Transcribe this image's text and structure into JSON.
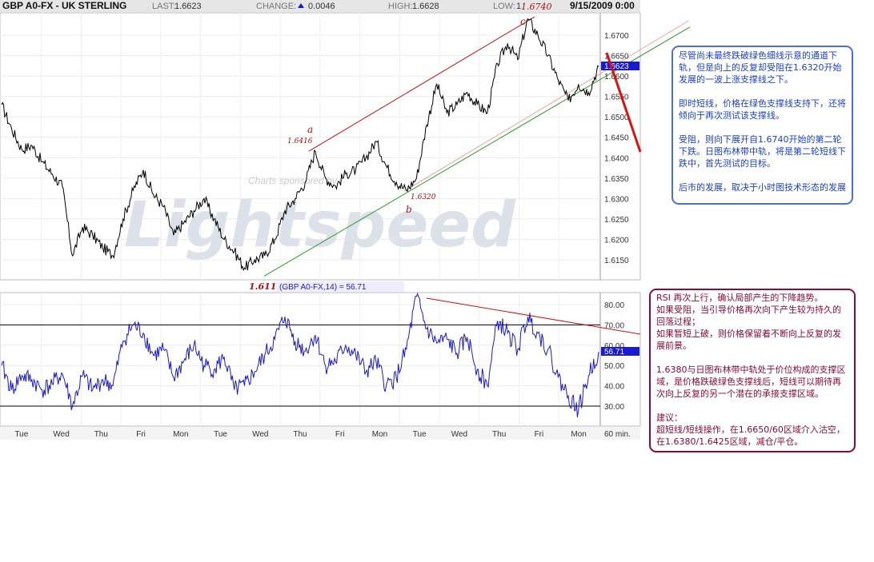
{
  "header": {
    "symbol": "GBP A0-FX - UK STERLING",
    "last_label": "LAST:",
    "last_value": "1.6623",
    "change_label": "CHANGE:",
    "change_value": "0.0046",
    "high_label": "HIGH:",
    "high_value": "1.6628",
    "low_label": "LOW:",
    "low_value": "1",
    "datetime": "9/15/2009 0:00"
  },
  "colors": {
    "price_line": "#000000",
    "rsi_line": "#1a1ad0",
    "channel_red": "#cc1111",
    "support_green": "#2a9a2a",
    "note_blue": "#1a3fd0",
    "note_red": "#8b0a3a",
    "badge_bg": "#1a1ad0"
  },
  "chart_data": [
    {
      "type": "line",
      "title": "GBP A0-FX - UK STERLING",
      "interval": "60 min.",
      "ylim": [
        1.611,
        1.675
      ],
      "yticks": [
        "1.6700",
        "1.6650",
        "1.6600",
        "1.6550",
        "1.6500",
        "1.6450",
        "1.6400",
        "1.6350",
        "1.6300",
        "1.6250",
        "1.6200",
        "1.6150"
      ],
      "last_value_label": "1.6623",
      "watermark": "Lightspeed",
      "watermark_small": "Charts sponsored by",
      "annotations": {
        "a": "a",
        "a_price": "1.6416",
        "b": "b",
        "b_price": "1.6320",
        "c": "c",
        "c_price": "1.6740",
        "low_price": "1.6110"
      },
      "series_anchors": [
        [
          0,
          1.653
        ],
        [
          1,
          1.647
        ],
        [
          2,
          1.642
        ],
        [
          3,
          1.643
        ],
        [
          4,
          1.639
        ],
        [
          5,
          1.636
        ],
        [
          6,
          1.633
        ],
        [
          7,
          1.616
        ],
        [
          8,
          1.623
        ],
        [
          9,
          1.621
        ],
        [
          10,
          1.618
        ],
        [
          11,
          1.616
        ],
        [
          12,
          1.625
        ],
        [
          13,
          1.632
        ],
        [
          14,
          1.637
        ],
        [
          15,
          1.631
        ],
        [
          16,
          1.628
        ],
        [
          17,
          1.621
        ],
        [
          18,
          1.624
        ],
        [
          19,
          1.627
        ],
        [
          20,
          1.63
        ],
        [
          21,
          1.625
        ],
        [
          22,
          1.62
        ],
        [
          23,
          1.617
        ],
        [
          24,
          1.613
        ],
        [
          25,
          1.615
        ],
        [
          26,
          1.616
        ],
        [
          27,
          1.62
        ],
        [
          28,
          1.627
        ],
        [
          29,
          1.63
        ],
        [
          30,
          1.634
        ],
        [
          31,
          1.6416
        ],
        [
          32,
          1.635
        ],
        [
          33,
          1.633
        ],
        [
          34,
          1.636
        ],
        [
          35,
          1.637
        ],
        [
          36,
          1.64
        ],
        [
          37,
          1.644
        ],
        [
          38,
          1.638
        ],
        [
          39,
          1.634
        ],
        [
          40,
          1.632
        ],
        [
          41,
          1.635
        ],
        [
          42,
          1.648
        ],
        [
          43,
          1.658
        ],
        [
          44,
          1.651
        ],
        [
          45,
          1.653
        ],
        [
          46,
          1.656
        ],
        [
          47,
          1.653
        ],
        [
          48,
          1.651
        ],
        [
          49,
          1.663
        ],
        [
          50,
          1.668
        ],
        [
          51,
          1.664
        ],
        [
          52,
          1.674
        ],
        [
          53,
          1.67
        ],
        [
          54,
          1.665
        ],
        [
          55,
          1.659
        ],
        [
          56,
          1.654
        ],
        [
          57,
          1.658
        ],
        [
          58,
          1.656
        ],
        [
          59,
          1.6623
        ]
      ],
      "series_name": ""
    },
    {
      "type": "line",
      "title": "(GBP A0-FX,14) = 56.71",
      "ylim": [
        25,
        85
      ],
      "yticks": [
        "80.00",
        "70.00",
        "60.00",
        "50.00",
        "40.00",
        "30.00"
      ],
      "hlines": [
        70,
        30
      ],
      "last_value_label": "56.71",
      "series_anchors": [
        [
          0,
          50
        ],
        [
          1,
          38
        ],
        [
          2,
          45
        ],
        [
          3,
          43
        ],
        [
          4,
          38
        ],
        [
          5,
          41
        ],
        [
          6,
          46
        ],
        [
          7,
          30
        ],
        [
          8,
          45
        ],
        [
          9,
          38
        ],
        [
          10,
          43
        ],
        [
          11,
          40
        ],
        [
          12,
          62
        ],
        [
          13,
          70
        ],
        [
          14,
          66
        ],
        [
          15,
          55
        ],
        [
          16,
          58
        ],
        [
          17,
          44
        ],
        [
          18,
          52
        ],
        [
          19,
          60
        ],
        [
          20,
          50
        ],
        [
          21,
          48
        ],
        [
          22,
          54
        ],
        [
          23,
          38
        ],
        [
          24,
          40
        ],
        [
          25,
          47
        ],
        [
          26,
          55
        ],
        [
          27,
          63
        ],
        [
          28,
          74
        ],
        [
          29,
          62
        ],
        [
          30,
          57
        ],
        [
          31,
          65
        ],
        [
          32,
          50
        ],
        [
          33,
          52
        ],
        [
          34,
          60
        ],
        [
          35,
          55
        ],
        [
          36,
          47
        ],
        [
          37,
          52
        ],
        [
          38,
          40
        ],
        [
          39,
          44
        ],
        [
          40,
          58
        ],
        [
          41,
          84
        ],
        [
          42,
          68
        ],
        [
          43,
          61
        ],
        [
          44,
          63
        ],
        [
          45,
          56
        ],
        [
          46,
          64
        ],
        [
          47,
          48
        ],
        [
          48,
          40
        ],
        [
          49,
          72
        ],
        [
          50,
          66
        ],
        [
          51,
          58
        ],
        [
          52,
          74
        ],
        [
          53,
          66
        ],
        [
          54,
          58
        ],
        [
          55,
          44
        ],
        [
          56,
          35
        ],
        [
          57,
          28
        ],
        [
          58,
          45
        ],
        [
          59,
          56.71
        ]
      ]
    }
  ],
  "x_axis": {
    "labels": [
      "Tue",
      "Wed",
      "Thu",
      "Fri",
      "Mon",
      "Tue",
      "Wed",
      "Thu",
      "Fri",
      "Mon",
      "Tue",
      "Wed",
      "Thu",
      "Fri",
      "Mon"
    ],
    "interval_label": "60 min."
  },
  "notes": {
    "blue": {
      "p1": "尽管尚未最终跌破绿色细线示意的通道下轨，但是向上的反复却受阻在1.6320开始发展的一波上涨支撑线之下。",
      "p2": "即时短线，价格在绿色支撑线支持下，还将倾向于再次测试该支撑线。",
      "p3": "受阻，则向下展开自1.6740开始的第二轮下跌。日图布林带中轨，将是第二轮短线下跌中，首先测试的目标。",
      "p4": "后市的发展，取决于小时图技术形态的发展"
    },
    "red": {
      "p1": "RSI 再次上行，确认局部产生的下降趋势。\n如果受阻，当引导价格再次向下产生较为持久的回落过程；\n如果暂短上破，则价格保留着不断向上反复的发展前景。",
      "p2": "1.6380与日图布林带中轨处于价位构成的支撑区域，是价格跌破绿色支撑线后，短线可以期待再次向上反复的另一个潜在的承接支撑区域。",
      "p3": "建议：\n超短线/短线操作，在1.6650/60区域介入沽空，在1.6380/1.6425区域，减仓/平仓。"
    }
  }
}
